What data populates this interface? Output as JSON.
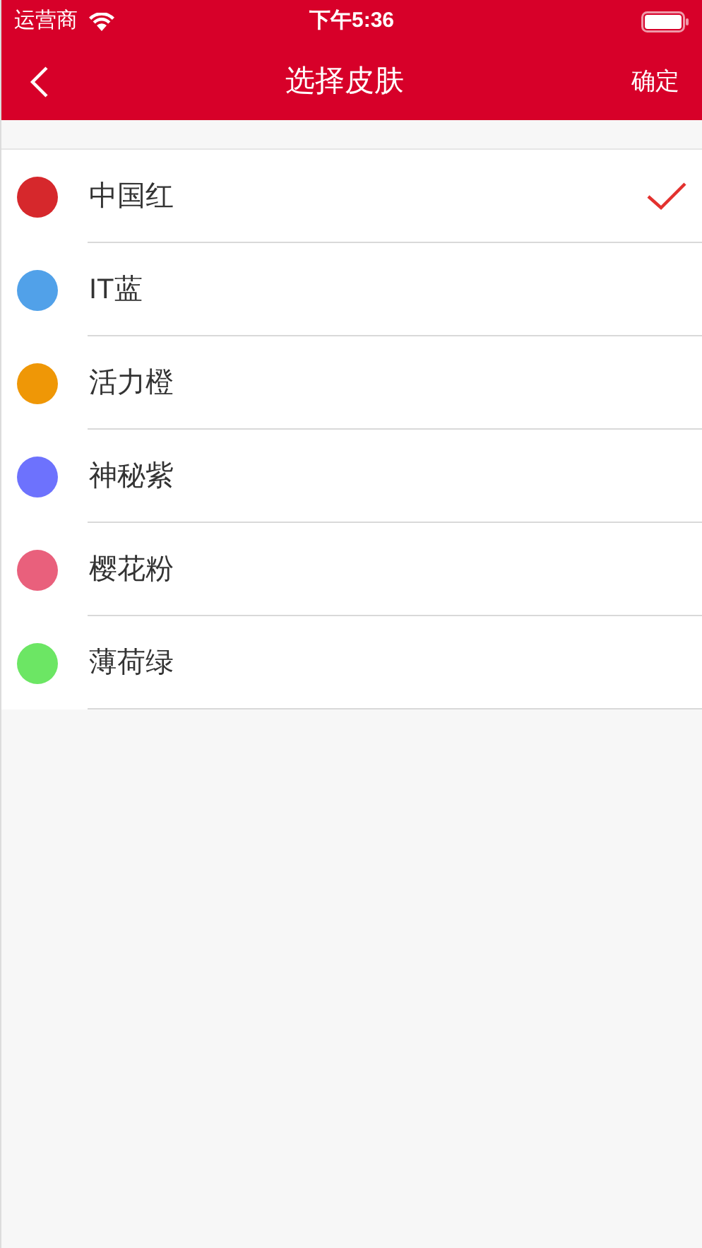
{
  "status_bar": {
    "carrier": "运营商",
    "time": "下午5:36"
  },
  "nav": {
    "title": "选择皮肤",
    "confirm": "确定"
  },
  "skins": [
    {
      "name": "中国红",
      "color": "#d6282c",
      "selected": true
    },
    {
      "name": "IT蓝",
      "color": "#51a1e9",
      "selected": false
    },
    {
      "name": "活力橙",
      "color": "#ef9706",
      "selected": false
    },
    {
      "name": "神秘紫",
      "color": "#6d72fd",
      "selected": false
    },
    {
      "name": "樱花粉",
      "color": "#e9607c",
      "selected": false
    },
    {
      "name": "薄荷绿",
      "color": "#6ce664",
      "selected": false
    }
  ]
}
